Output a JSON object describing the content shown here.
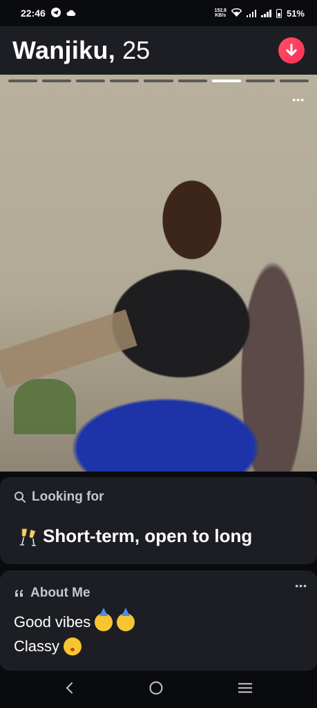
{
  "status_bar": {
    "time": "22:46",
    "net_speed_value": "152.8",
    "net_speed_unit": "KB/s",
    "battery": "51%"
  },
  "profile": {
    "name": "Wanjiku,",
    "age": "25",
    "photo_count": 9,
    "active_photo_index": 6
  },
  "looking_for": {
    "heading": "Looking for",
    "value": "Short-term, open to long",
    "icon": "champagne-icon"
  },
  "about_me": {
    "heading": "About Me",
    "bio_line1": "Good vibes",
    "bio_line2": "Classy"
  },
  "colors": {
    "accent": "#fd5068",
    "card_bg": "#1c1e24",
    "page_bg": "#0a0b0f"
  }
}
